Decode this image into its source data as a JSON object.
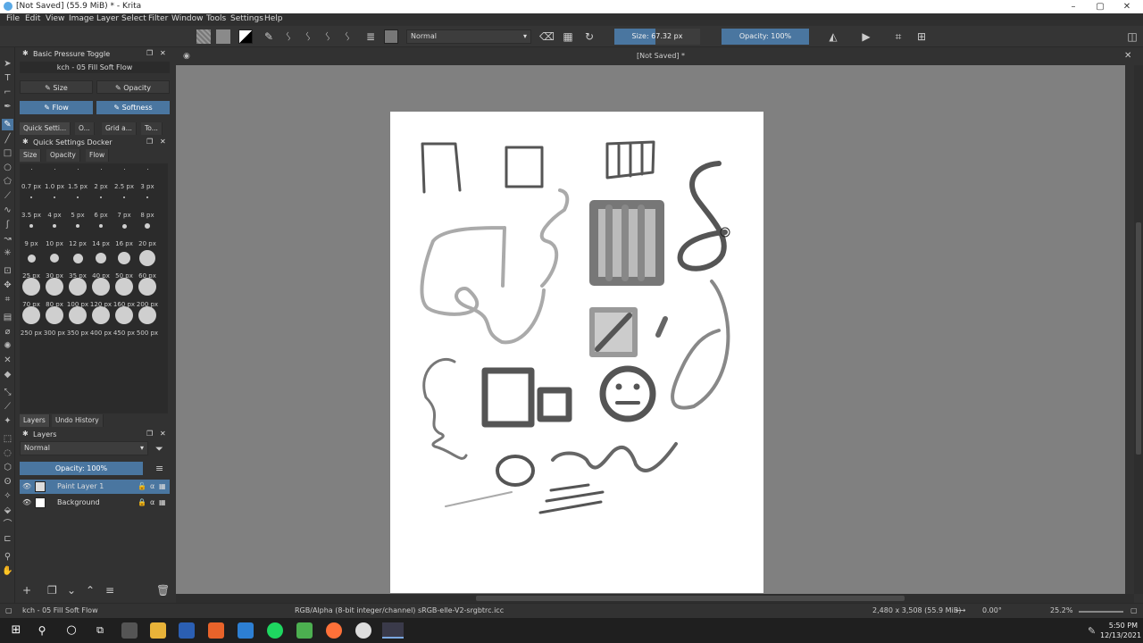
{
  "window": {
    "title": "[Not Saved]  (55.9 MiB)  * - Krita",
    "min": "–",
    "max": "▢",
    "close": "✕"
  },
  "menu": [
    "File",
    "Edit",
    "View",
    "Image",
    "Layer",
    "Select",
    "Filter",
    "Window",
    "Tools",
    "Settings",
    "Help"
  ],
  "toolbar": {
    "blend_mode": "Normal",
    "size_label": "Size: 67.32 px",
    "opacity_label": "Opacity: 100%",
    "size_fraction": 0.48,
    "opacity_fraction": 1.0
  },
  "brush_docker": {
    "title": "Basic Pressure Toggle",
    "preset": "kch - 05 Fill Soft Flow",
    "buttons": [
      "Size",
      "Opacity",
      "Flow",
      "Softness"
    ]
  },
  "tabs": [
    "Quick Setti...",
    "O...",
    "Grid a...",
    "To..."
  ],
  "quick_settings": {
    "title": "Quick Settings Docker",
    "tabs": [
      "Size",
      "Opacity",
      "Flow"
    ],
    "sizes": [
      [
        "0.7 px",
        "1.0 px",
        "1.5 px",
        "2 px",
        "2.5 px",
        "3 px"
      ],
      [
        "3.5 px",
        "4 px",
        "5 px",
        "6 px",
        "7 px",
        "8 px"
      ],
      [
        "9 px",
        "10 px",
        "12 px",
        "14 px",
        "16 px",
        "20 px"
      ],
      [
        "25 px",
        "30 px",
        "35 px",
        "40 px",
        "50 px",
        "60 px"
      ],
      [
        "70 px",
        "80 px",
        "100 px",
        "120 px",
        "160 px",
        "200 px"
      ],
      [
        "250 px",
        "300 px",
        "350 px",
        "400 px",
        "450 px",
        "500 px"
      ]
    ]
  },
  "layers_tabs": [
    "Layers",
    "Undo History"
  ],
  "layers": {
    "title": "Layers",
    "blend": "Normal",
    "opacity": "Opacity:  100%",
    "items": [
      "Paint Layer 1",
      "Background"
    ]
  },
  "document": {
    "tab_title": "[Not Saved]  *",
    "close": "✕"
  },
  "status": {
    "preset": "kch - 05 Fill Soft Flow",
    "colorspace": "RGB/Alpha (8-bit integer/channel)  sRGB-elle-V2-srgbtrc.icc",
    "dimensions": "2,480 x 3,508 (55.9 MiB)",
    "rotation": "0.00°",
    "zoom": "25.2%"
  },
  "clock": {
    "time": "5:50 PM",
    "date": "12/13/2021"
  }
}
